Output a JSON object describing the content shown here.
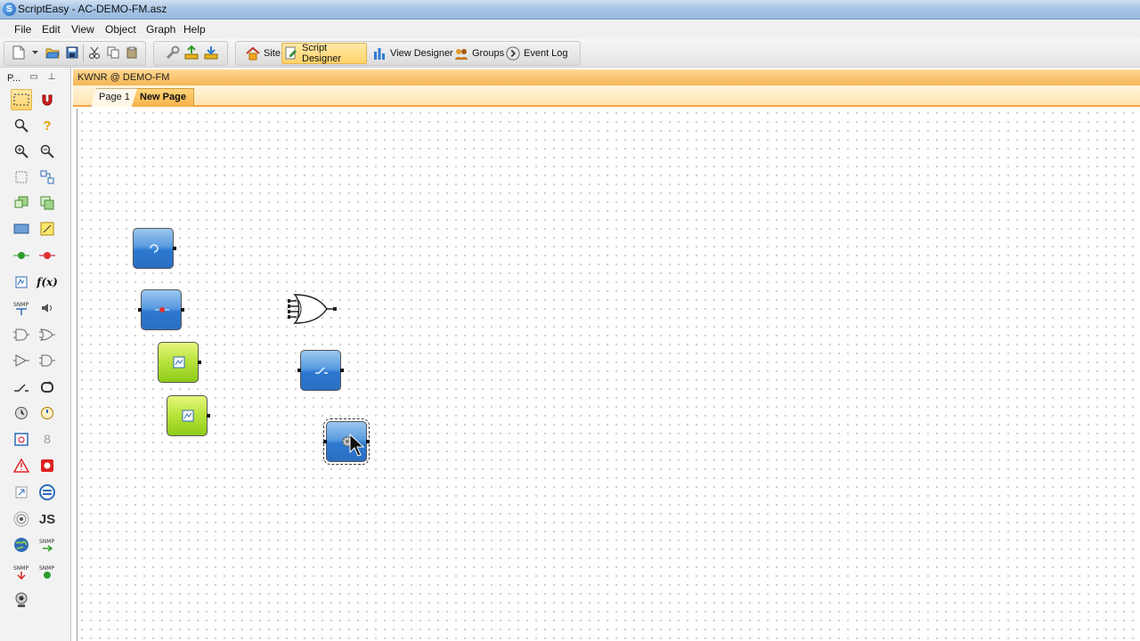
{
  "window": {
    "title": "ScriptEasy - AC-DEMO-FM.asz"
  },
  "menu": {
    "items": [
      "File",
      "Edit",
      "View",
      "Object",
      "Graph",
      "Help"
    ]
  },
  "toolbar": {
    "site_label": "Site",
    "script_designer_label": "Script Designer",
    "view_designer_label": "View Designer",
    "groups_label": "Groups",
    "event_log_label": "Event Log",
    "active_tool": "Script Designer"
  },
  "palette": {
    "title": "P...",
    "pin_icon": "pin-icon",
    "float_icon": "float-icon"
  },
  "document": {
    "title": "KWNR @ DEMO-FM"
  },
  "page_tabs": {
    "tabs": [
      "Page 1",
      "New Page"
    ],
    "active": "New Page"
  },
  "canvas": {
    "blocks": [
      {
        "kind": "blue-input-block",
        "icon": "circle-arrow-icon"
      },
      {
        "kind": "blue-input-block",
        "icon": "red-dot-icon"
      },
      {
        "kind": "green-function-block",
        "icon": "function-icon"
      },
      {
        "kind": "green-function-block",
        "icon": "function-icon"
      },
      {
        "kind": "or-gate",
        "icon": "or-gate-icon"
      },
      {
        "kind": "blue-switch-block",
        "icon": "switch-icon"
      },
      {
        "kind": "blue-gear-block",
        "icon": "gear-icon",
        "selected": true
      }
    ]
  },
  "colors": {
    "accent_orange": "#f6b554",
    "selection_yellow": "#ffd36a",
    "block_blue": "#2d78d0",
    "block_green": "#8ecb1a"
  }
}
